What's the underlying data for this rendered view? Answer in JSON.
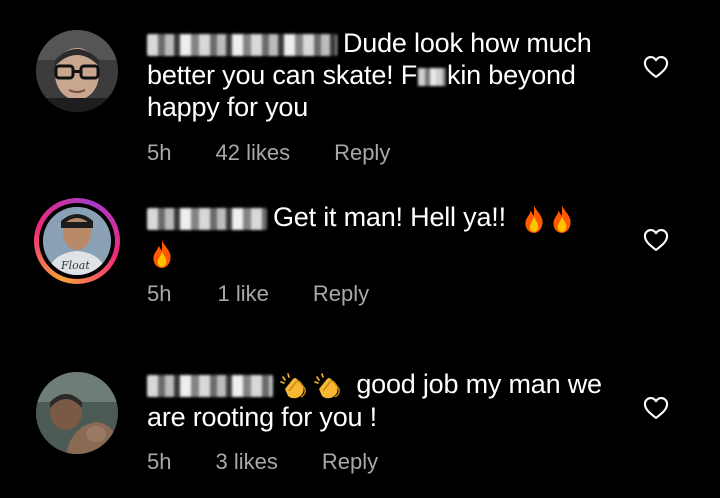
{
  "comments": [
    {
      "username_redacted": true,
      "text_before_redaction": "Dude look how much better you can skate! F",
      "text_after_redaction": "kin beyond happy for you",
      "time": "5h",
      "likes": "42 likes",
      "reply_label": "Reply",
      "avatar_icon": "avatar-man-glasses-icon",
      "heart_icon": "heart-outline-icon"
    },
    {
      "username_redacted": true,
      "text": "Get it man! Hell ya!!",
      "trailing_emojis": [
        "fire",
        "fire",
        "fire"
      ],
      "time": "5h",
      "likes": "1 like",
      "reply_label": "Reply",
      "avatar_icon": "avatar-story-ring-icon",
      "avatar_shirt_text": "Float",
      "heart_icon": "heart-outline-icon"
    },
    {
      "username_redacted": true,
      "leading_emojis": [
        "clapping-hands",
        "clapping-hands"
      ],
      "text": "good job my man we are rooting for you !",
      "time": "5h",
      "likes": "3 likes",
      "reply_label": "Reply",
      "avatar_icon": "avatar-photo-icon",
      "heart_icon": "heart-outline-icon"
    }
  ],
  "colors": {
    "background": "#000000",
    "text": "#ffffff",
    "meta_text": "#a8a8a8",
    "story_ring_start": "#f9a13a",
    "story_ring_end": "#a43bc8",
    "fire": "#ff6a00"
  }
}
